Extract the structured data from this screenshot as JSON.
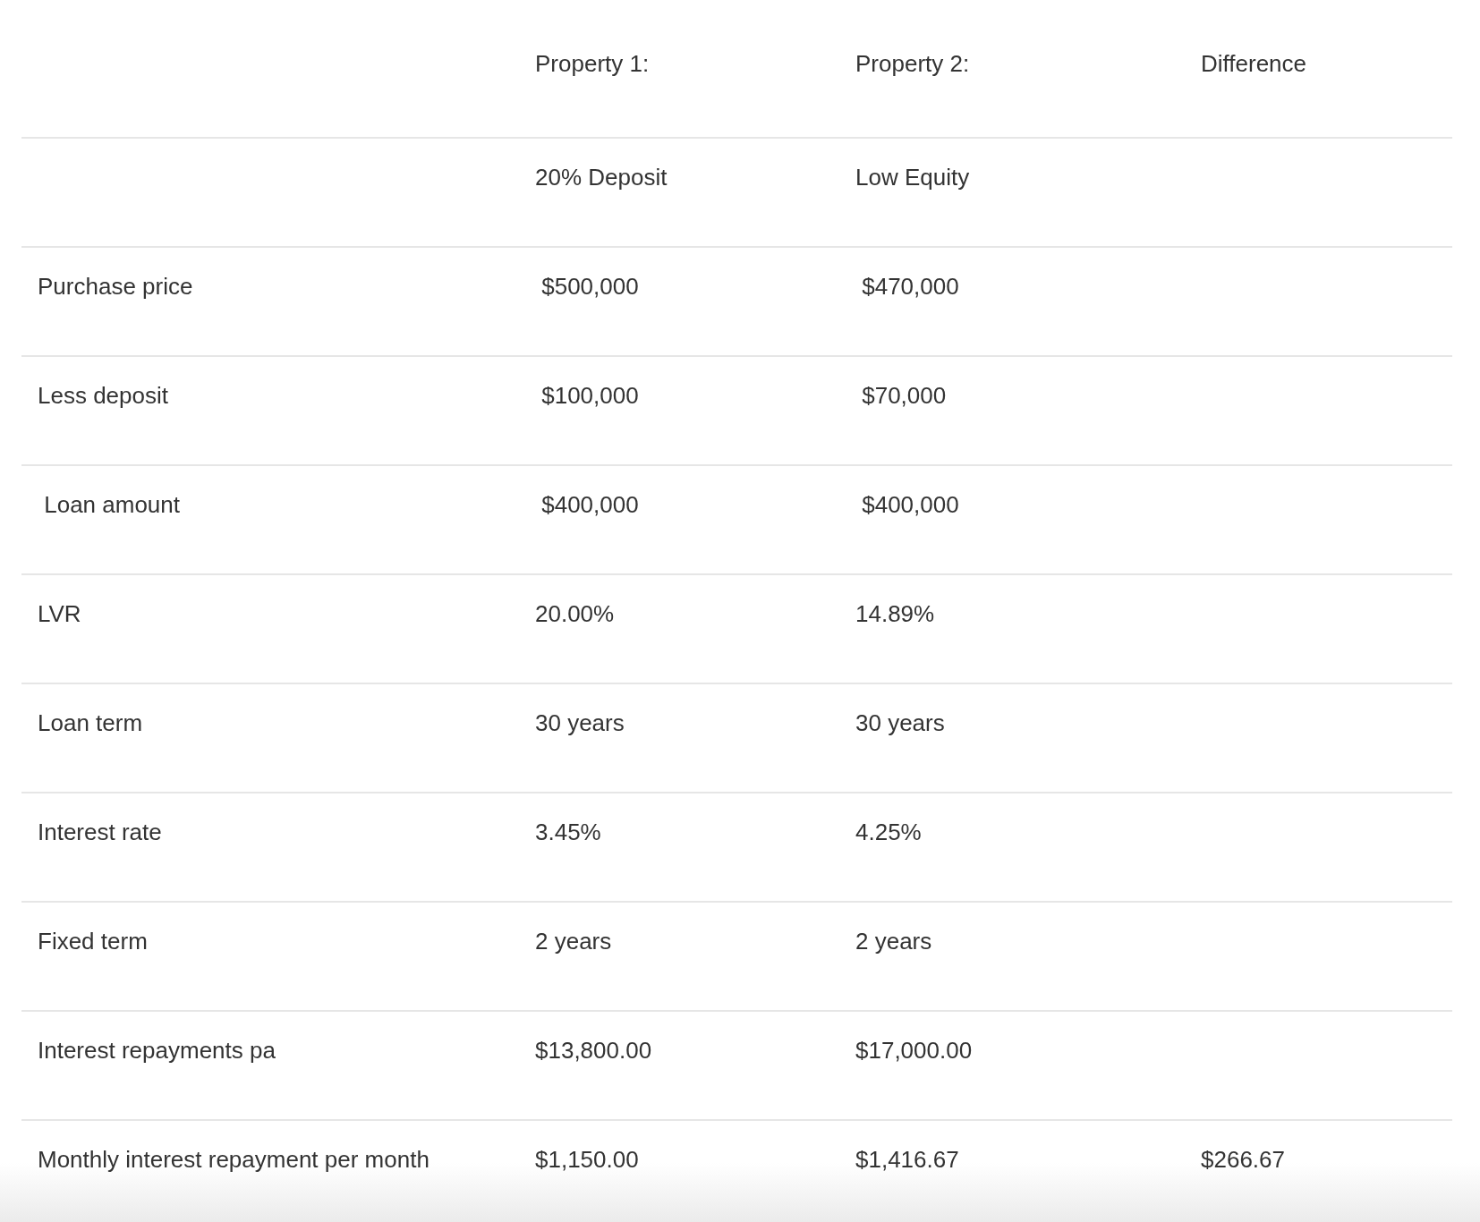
{
  "table": {
    "columns": [
      "Property 1:",
      "Property 2:",
      "Difference"
    ],
    "rows": [
      {
        "cells": [
          "20% Deposit",
          "Low Equity"
        ]
      },
      {
        "label": "Purchase price",
        "cells": [
          " $500,000",
          " $470,000"
        ]
      },
      {
        "label": "Less deposit",
        "cells": [
          " $100,000",
          " $70,000"
        ]
      },
      {
        "label": " Loan amount",
        "cells": [
          " $400,000",
          " $400,000"
        ]
      },
      {
        "label": "LVR",
        "cells": [
          "20.00%",
          "14.89%"
        ]
      },
      {
        "label": "Loan term",
        "cells": [
          "30 years",
          "30 years"
        ]
      },
      {
        "label": "Interest rate",
        "cells": [
          "3.45%",
          "4.25%"
        ]
      },
      {
        "label": "Fixed term",
        "cells": [
          "2 years",
          "2 years"
        ]
      },
      {
        "label": "Interest repayments pa",
        "cells": [
          "$13,800.00",
          "$17,000.00"
        ]
      },
      {
        "label": "Monthly interest repayment per month",
        "cells": [
          "$1,150.00",
          "$1,416.67",
          "$266.67"
        ]
      }
    ]
  }
}
